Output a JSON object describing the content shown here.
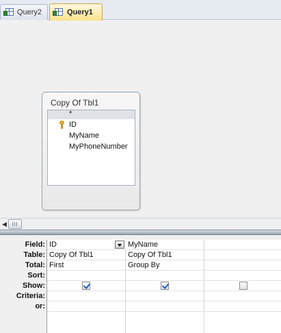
{
  "tabs": [
    {
      "label": "Query2",
      "active": false,
      "icon": "query-icon"
    },
    {
      "label": "Query1",
      "active": true,
      "icon": "query-icon"
    }
  ],
  "table_box": {
    "title": "Copy Of Tbl1",
    "fields": [
      {
        "name": "*",
        "primary_key": false
      },
      {
        "name": "ID",
        "primary_key": true
      },
      {
        "name": "MyName",
        "primary_key": false
      },
      {
        "name": "MyPhoneNumber",
        "primary_key": false
      }
    ]
  },
  "grid": {
    "row_labels": {
      "field": "Field:",
      "table": "Table:",
      "total": "Total:",
      "sort": "Sort:",
      "show": "Show:",
      "criteria": "Criteria:",
      "or": "or:"
    },
    "columns": [
      {
        "field": "ID",
        "table": "Copy Of Tbl1",
        "total": "First",
        "sort": "",
        "show": true,
        "criteria": "",
        "or": "",
        "has_dropdown": true
      },
      {
        "field": "MyName",
        "table": "Copy Of Tbl1",
        "total": "Group By",
        "sort": "",
        "show": true,
        "criteria": "",
        "or": "",
        "has_dropdown": false
      },
      {
        "field": "",
        "table": "",
        "total": "",
        "sort": "",
        "show": false,
        "criteria": "",
        "or": "",
        "has_dropdown": false
      }
    ]
  },
  "colors": {
    "active_tab": "#fde28c",
    "design_background": "#f0f0f0",
    "checkbox_check": "#1f5fbf"
  }
}
